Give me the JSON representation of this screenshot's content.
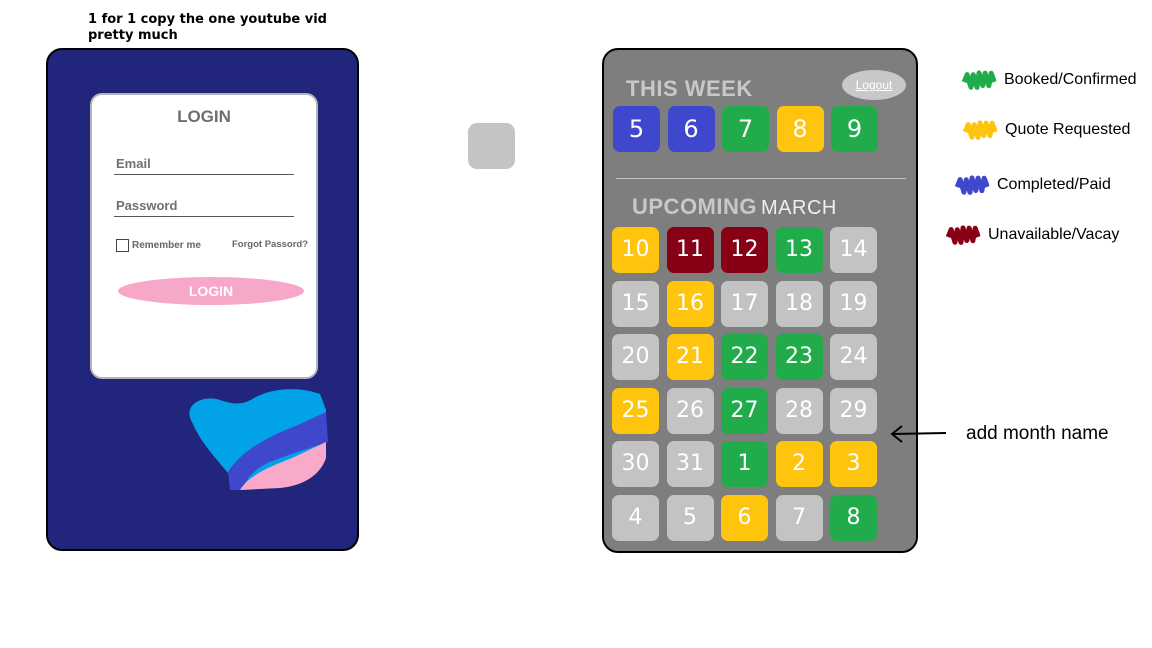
{
  "note": "1 for 1 copy the one youtube vid pretty much",
  "login": {
    "title": "LOGIN",
    "email_placeholder": "Email",
    "password_placeholder": "Password",
    "remember_label": "Remember me",
    "forgot_label": "Forgot Passord?",
    "button_label": "LOGIN"
  },
  "calendar": {
    "this_week_title": "THIS WEEK",
    "logout_label": "Logout",
    "upcoming_title": "UPCOMING",
    "month_name": "MARCH",
    "colors": {
      "booked": "#22ab4b",
      "quote": "#fec40e",
      "completed": "#3f48cc",
      "unavailable": "#880015",
      "empty": "#c3c3c3"
    },
    "this_week": [
      {
        "day": "5",
        "status": "completed"
      },
      {
        "day": "6",
        "status": "completed"
      },
      {
        "day": "7",
        "status": "booked"
      },
      {
        "day": "8",
        "status": "quote"
      },
      {
        "day": "9",
        "status": "booked"
      }
    ],
    "upcoming": [
      {
        "day": "10",
        "status": "quote"
      },
      {
        "day": "11",
        "status": "unavailable"
      },
      {
        "day": "12",
        "status": "unavailable"
      },
      {
        "day": "13",
        "status": "booked"
      },
      {
        "day": "14",
        "status": "empty"
      },
      {
        "day": "15",
        "status": "empty"
      },
      {
        "day": "16",
        "status": "quote"
      },
      {
        "day": "17",
        "status": "empty"
      },
      {
        "day": "18",
        "status": "empty"
      },
      {
        "day": "19",
        "status": "empty"
      },
      {
        "day": "20",
        "status": "empty"
      },
      {
        "day": "21",
        "status": "quote"
      },
      {
        "day": "22",
        "status": "booked"
      },
      {
        "day": "23",
        "status": "booked"
      },
      {
        "day": "24",
        "status": "empty"
      },
      {
        "day": "25",
        "status": "quote"
      },
      {
        "day": "26",
        "status": "empty"
      },
      {
        "day": "27",
        "status": "booked"
      },
      {
        "day": "28",
        "status": "empty"
      },
      {
        "day": "29",
        "status": "empty"
      },
      {
        "day": "30",
        "status": "empty"
      },
      {
        "day": "31",
        "status": "empty"
      },
      {
        "day": "1",
        "status": "booked"
      },
      {
        "day": "2",
        "status": "quote"
      },
      {
        "day": "3",
        "status": "quote"
      },
      {
        "day": "4",
        "status": "empty"
      },
      {
        "day": "5",
        "status": "empty"
      },
      {
        "day": "6",
        "status": "quote"
      },
      {
        "day": "7",
        "status": "empty"
      },
      {
        "day": "8",
        "status": "booked"
      }
    ]
  },
  "legend": [
    {
      "label": "Booked/Confirmed",
      "color": "#22ab4b"
    },
    {
      "label": "Quote Requested",
      "color": "#fec40e"
    },
    {
      "label": "Completed/Paid",
      "color": "#3f48cc"
    },
    {
      "label": "Unavailable/Vacay",
      "color": "#880015"
    }
  ],
  "annotation": "add month name"
}
